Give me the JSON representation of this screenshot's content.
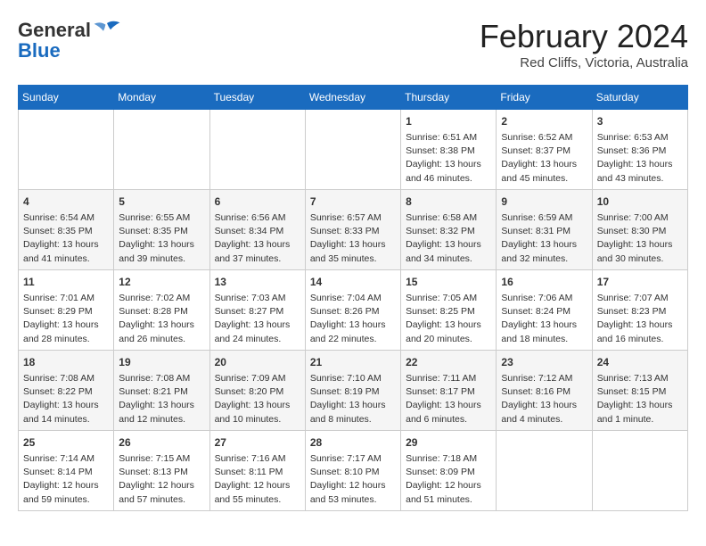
{
  "header": {
    "logo_general": "General",
    "logo_blue": "Blue",
    "month_year": "February 2024",
    "location": "Red Cliffs, Victoria, Australia"
  },
  "days_of_week": [
    "Sunday",
    "Monday",
    "Tuesday",
    "Wednesday",
    "Thursday",
    "Friday",
    "Saturday"
  ],
  "weeks": [
    [
      {
        "day": "",
        "info": ""
      },
      {
        "day": "",
        "info": ""
      },
      {
        "day": "",
        "info": ""
      },
      {
        "day": "",
        "info": ""
      },
      {
        "day": "1",
        "info": "Sunrise: 6:51 AM\nSunset: 8:38 PM\nDaylight: 13 hours and 46 minutes."
      },
      {
        "day": "2",
        "info": "Sunrise: 6:52 AM\nSunset: 8:37 PM\nDaylight: 13 hours and 45 minutes."
      },
      {
        "day": "3",
        "info": "Sunrise: 6:53 AM\nSunset: 8:36 PM\nDaylight: 13 hours and 43 minutes."
      }
    ],
    [
      {
        "day": "4",
        "info": "Sunrise: 6:54 AM\nSunset: 8:35 PM\nDaylight: 13 hours and 41 minutes."
      },
      {
        "day": "5",
        "info": "Sunrise: 6:55 AM\nSunset: 8:35 PM\nDaylight: 13 hours and 39 minutes."
      },
      {
        "day": "6",
        "info": "Sunrise: 6:56 AM\nSunset: 8:34 PM\nDaylight: 13 hours and 37 minutes."
      },
      {
        "day": "7",
        "info": "Sunrise: 6:57 AM\nSunset: 8:33 PM\nDaylight: 13 hours and 35 minutes."
      },
      {
        "day": "8",
        "info": "Sunrise: 6:58 AM\nSunset: 8:32 PM\nDaylight: 13 hours and 34 minutes."
      },
      {
        "day": "9",
        "info": "Sunrise: 6:59 AM\nSunset: 8:31 PM\nDaylight: 13 hours and 32 minutes."
      },
      {
        "day": "10",
        "info": "Sunrise: 7:00 AM\nSunset: 8:30 PM\nDaylight: 13 hours and 30 minutes."
      }
    ],
    [
      {
        "day": "11",
        "info": "Sunrise: 7:01 AM\nSunset: 8:29 PM\nDaylight: 13 hours and 28 minutes."
      },
      {
        "day": "12",
        "info": "Sunrise: 7:02 AM\nSunset: 8:28 PM\nDaylight: 13 hours and 26 minutes."
      },
      {
        "day": "13",
        "info": "Sunrise: 7:03 AM\nSunset: 8:27 PM\nDaylight: 13 hours and 24 minutes."
      },
      {
        "day": "14",
        "info": "Sunrise: 7:04 AM\nSunset: 8:26 PM\nDaylight: 13 hours and 22 minutes."
      },
      {
        "day": "15",
        "info": "Sunrise: 7:05 AM\nSunset: 8:25 PM\nDaylight: 13 hours and 20 minutes."
      },
      {
        "day": "16",
        "info": "Sunrise: 7:06 AM\nSunset: 8:24 PM\nDaylight: 13 hours and 18 minutes."
      },
      {
        "day": "17",
        "info": "Sunrise: 7:07 AM\nSunset: 8:23 PM\nDaylight: 13 hours and 16 minutes."
      }
    ],
    [
      {
        "day": "18",
        "info": "Sunrise: 7:08 AM\nSunset: 8:22 PM\nDaylight: 13 hours and 14 minutes."
      },
      {
        "day": "19",
        "info": "Sunrise: 7:08 AM\nSunset: 8:21 PM\nDaylight: 13 hours and 12 minutes."
      },
      {
        "day": "20",
        "info": "Sunrise: 7:09 AM\nSunset: 8:20 PM\nDaylight: 13 hours and 10 minutes."
      },
      {
        "day": "21",
        "info": "Sunrise: 7:10 AM\nSunset: 8:19 PM\nDaylight: 13 hours and 8 minutes."
      },
      {
        "day": "22",
        "info": "Sunrise: 7:11 AM\nSunset: 8:17 PM\nDaylight: 13 hours and 6 minutes."
      },
      {
        "day": "23",
        "info": "Sunrise: 7:12 AM\nSunset: 8:16 PM\nDaylight: 13 hours and 4 minutes."
      },
      {
        "day": "24",
        "info": "Sunrise: 7:13 AM\nSunset: 8:15 PM\nDaylight: 13 hours and 1 minute."
      }
    ],
    [
      {
        "day": "25",
        "info": "Sunrise: 7:14 AM\nSunset: 8:14 PM\nDaylight: 12 hours and 59 minutes."
      },
      {
        "day": "26",
        "info": "Sunrise: 7:15 AM\nSunset: 8:13 PM\nDaylight: 12 hours and 57 minutes."
      },
      {
        "day": "27",
        "info": "Sunrise: 7:16 AM\nSunset: 8:11 PM\nDaylight: 12 hours and 55 minutes."
      },
      {
        "day": "28",
        "info": "Sunrise: 7:17 AM\nSunset: 8:10 PM\nDaylight: 12 hours and 53 minutes."
      },
      {
        "day": "29",
        "info": "Sunrise: 7:18 AM\nSunset: 8:09 PM\nDaylight: 12 hours and 51 minutes."
      },
      {
        "day": "",
        "info": ""
      },
      {
        "day": "",
        "info": ""
      }
    ]
  ]
}
